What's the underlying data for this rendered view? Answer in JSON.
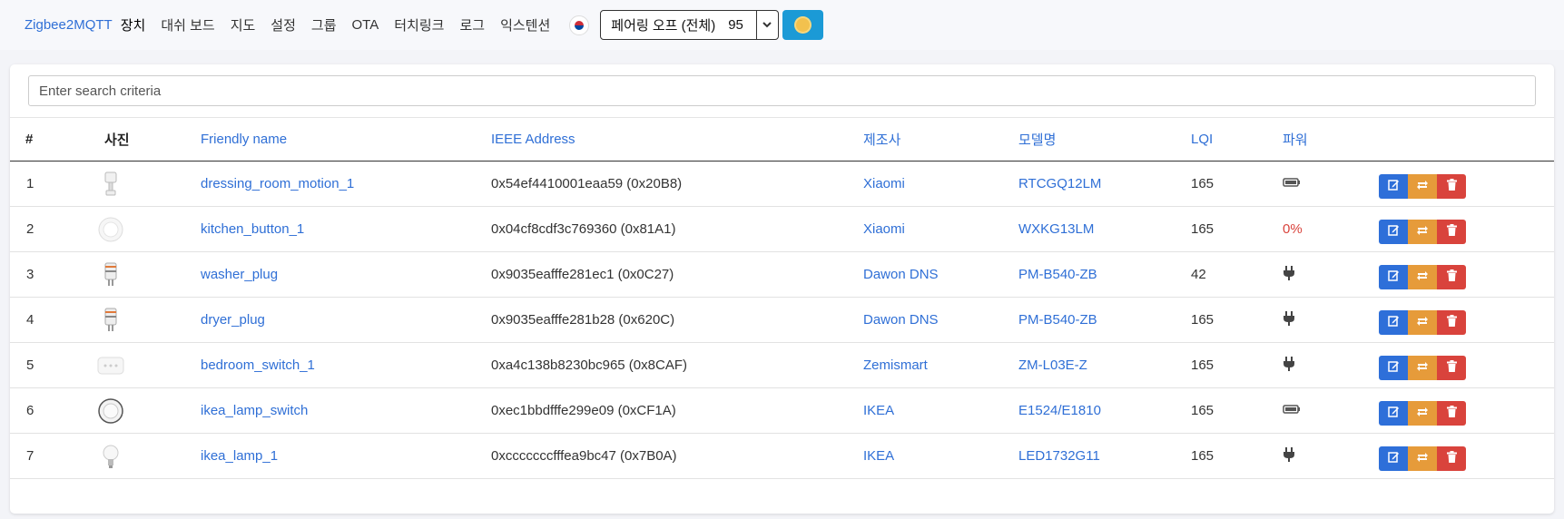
{
  "navbar": {
    "brand": "Zigbee2MQTT",
    "items": [
      {
        "label": "장치",
        "active": true
      },
      {
        "label": "대쉬 보드"
      },
      {
        "label": "지도"
      },
      {
        "label": "설정"
      },
      {
        "label": "그룹"
      },
      {
        "label": "OTA"
      },
      {
        "label": "터치링크"
      },
      {
        "label": "로그"
      },
      {
        "label": "익스텐션"
      }
    ],
    "language_icon": "korean-flag-icon",
    "permit_join": {
      "label": "페어링 오프 (전체)",
      "count": "95"
    },
    "theme_icon": "sun-icon"
  },
  "search": {
    "placeholder": "Enter search criteria",
    "value": ""
  },
  "table": {
    "headers": {
      "index": "#",
      "picture": "사진",
      "friendly_name": "Friendly name",
      "ieee": "IEEE Address",
      "manufacturer": "제조사",
      "model": "모델명",
      "lqi": "LQI",
      "power": "파워"
    },
    "rows": [
      {
        "index": "1",
        "picture": "motion-sensor-image",
        "friendly_name": "dressing_room_motion_1",
        "ieee": "0x54ef4410001eaa59 (0x20B8)",
        "manufacturer": "Xiaomi",
        "model": "RTCGQ12LM",
        "lqi": "165",
        "power_icon": "battery-icon",
        "power_text": ""
      },
      {
        "index": "2",
        "picture": "button-image",
        "friendly_name": "kitchen_button_1",
        "ieee": "0x04cf8cdf3c769360 (0x81A1)",
        "manufacturer": "Xiaomi",
        "model": "WXKG13LM",
        "lqi": "165",
        "power_icon": "",
        "power_text": "0%"
      },
      {
        "index": "3",
        "picture": "plug-image",
        "friendly_name": "washer_plug",
        "ieee": "0x9035eafffe281ec1 (0x0C27)",
        "manufacturer": "Dawon DNS",
        "model": "PM-B540-ZB",
        "lqi": "42",
        "power_icon": "plug-icon",
        "power_text": ""
      },
      {
        "index": "4",
        "picture": "plug-image",
        "friendly_name": "dryer_plug",
        "ieee": "0x9035eafffe281b28 (0x620C)",
        "manufacturer": "Dawon DNS",
        "model": "PM-B540-ZB",
        "lqi": "165",
        "power_icon": "plug-icon",
        "power_text": ""
      },
      {
        "index": "5",
        "picture": "wall-switch-image",
        "friendly_name": "bedroom_switch_1",
        "ieee": "0xa4c138b8230bc965 (0x8CAF)",
        "manufacturer": "Zemismart",
        "model": "ZM-L03E-Z",
        "lqi": "165",
        "power_icon": "plug-icon",
        "power_text": ""
      },
      {
        "index": "6",
        "picture": "round-remote-image",
        "friendly_name": "ikea_lamp_switch",
        "ieee": "0xec1bbdfffe299e09 (0xCF1A)",
        "manufacturer": "IKEA",
        "model": "E1524/E1810",
        "lqi": "165",
        "power_icon": "battery-icon",
        "power_text": ""
      },
      {
        "index": "7",
        "picture": "bulb-image",
        "friendly_name": "ikea_lamp_1",
        "ieee": "0xcccccccfffea9bc47 (0x7B0A)",
        "manufacturer": "IKEA",
        "model": "LED1732G11",
        "lqi": "165",
        "power_icon": "plug-icon",
        "power_text": ""
      }
    ],
    "row_action_icons": [
      "edit-icon",
      "rename-icon",
      "trash-icon"
    ]
  },
  "colors": {
    "link": "#2f6fd6",
    "edit": "#2e6fd9",
    "rename": "#e69b3a",
    "remove": "#d9433c",
    "theme_button": "#1b9ad6"
  }
}
